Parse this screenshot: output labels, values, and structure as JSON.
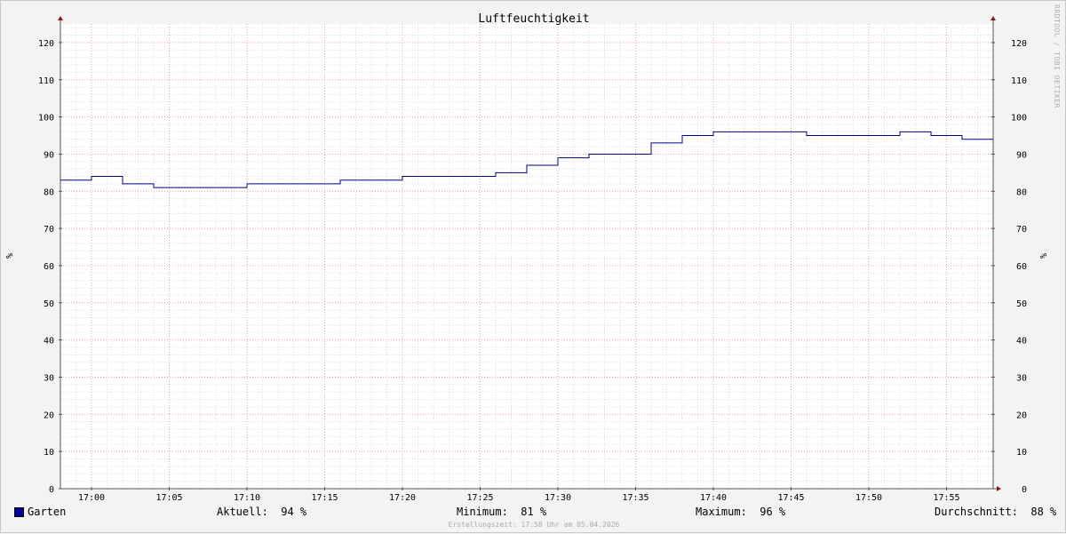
{
  "chart_data": {
    "type": "line",
    "title": "Luftfeuchtigkeit",
    "ylabel": "%",
    "ylim": [
      0,
      125
    ],
    "y_ticks": [
      0,
      10,
      20,
      30,
      40,
      50,
      60,
      70,
      80,
      90,
      100,
      110,
      120
    ],
    "x_ticks": [
      "17:00",
      "17:05",
      "17:10",
      "17:15",
      "17:20",
      "17:25",
      "17:30",
      "17:35",
      "17:40",
      "17:45",
      "17:50",
      "17:55"
    ],
    "x_range": [
      "16:58",
      "17:58"
    ],
    "grid": true,
    "line_color": "#000080",
    "series": [
      {
        "name": "Garten",
        "x": [
          "16:58",
          "17:00",
          "17:02",
          "17:04",
          "17:10",
          "17:16",
          "17:20",
          "17:26",
          "17:28",
          "17:30",
          "17:32",
          "17:36",
          "17:38",
          "17:40",
          "17:46",
          "17:52",
          "17:54",
          "17:56",
          "17:58"
        ],
        "values": [
          83,
          84,
          82,
          81,
          82,
          83,
          84,
          85,
          87,
          89,
          90,
          93,
          95,
          96,
          95,
          96,
          95,
          94,
          94
        ]
      }
    ]
  },
  "legend": {
    "series_name": "Garten",
    "series_color": "#00009c",
    "aktuell": "Aktuell:  94 %",
    "minimum": "Minimum:  81 %",
    "maximum": "Maximum:  96 %",
    "durchschnitt": "Durchschnitt:  88 %"
  },
  "footer": "Erstellungszeit: 17:58 Uhr am 05.04.2026",
  "watermark": "RRDTOOL / TOBI OETIKER"
}
